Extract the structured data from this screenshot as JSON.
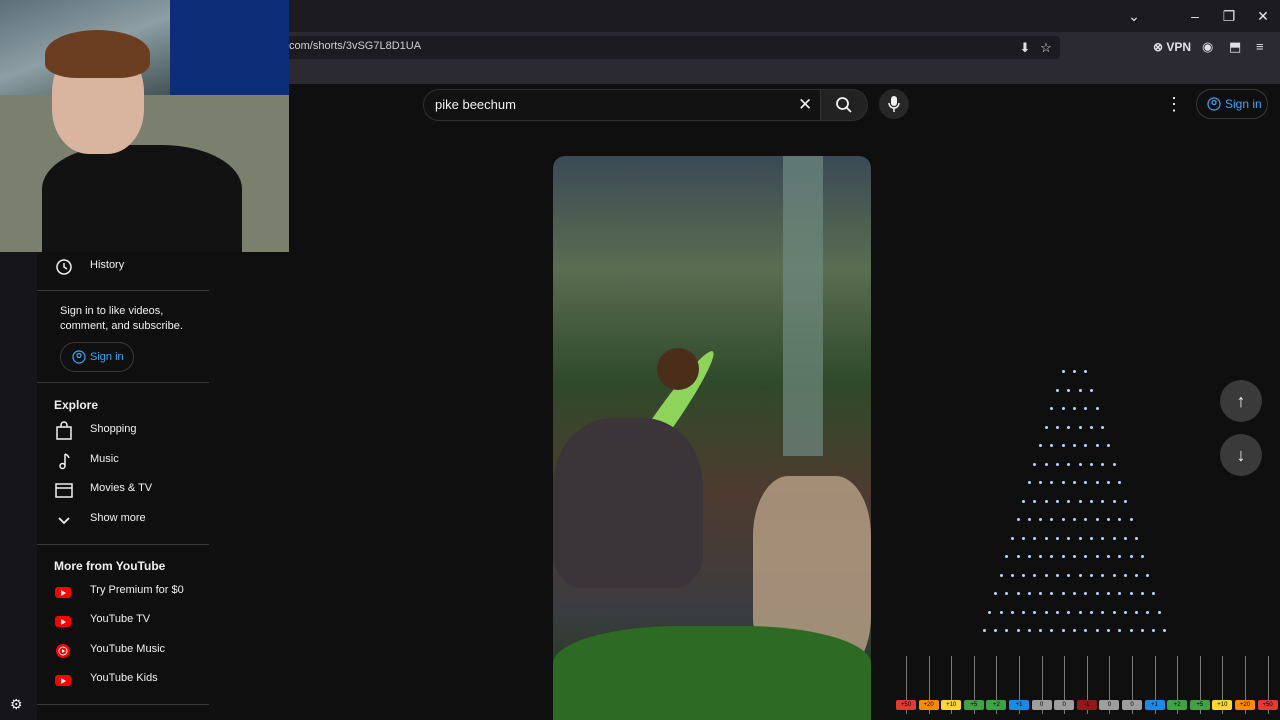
{
  "browser": {
    "url": "com/shorts/3vSG7L8D1UA",
    "vpn_label": "VPN",
    "window_controls": [
      "chevron-down-icon",
      "minimize-icon",
      "restore-icon",
      "close-icon"
    ]
  },
  "header": {
    "search_value": "pike beechum",
    "signin_label": "Sign in"
  },
  "sidebar": {
    "history_label": "History",
    "signin_note": "Sign in to like videos, comment, and subscribe.",
    "signin_label": "Sign in",
    "explore_heading": "Explore",
    "explore_items": [
      {
        "label": "Shopping",
        "icon": "shopping-bag-icon"
      },
      {
        "label": "Music",
        "icon": "music-note-icon"
      },
      {
        "label": "Movies & TV",
        "icon": "clapperboard-icon"
      },
      {
        "label": "Show more",
        "icon": "chevron-down-icon"
      }
    ],
    "more_heading": "More from YouTube",
    "more_items": [
      {
        "label": "Try Premium for $0",
        "icon": "youtube-premium-icon"
      },
      {
        "label": "YouTube TV",
        "icon": "youtube-tv-icon"
      },
      {
        "label": "YouTube Music",
        "icon": "youtube-music-icon"
      },
      {
        "label": "YouTube Kids",
        "icon": "youtube-kids-icon"
      }
    ]
  },
  "visualizer": {
    "meter_labels": [
      "+50",
      "+20",
      "+10",
      "+5",
      "+2",
      "+1",
      "0",
      "0",
      "-1",
      "0",
      "0",
      "+1",
      "+2",
      "+5",
      "+10",
      "+20",
      "+50"
    ],
    "meter_colors": [
      "#e53935",
      "#fb8c00",
      "#fdd835",
      "#43a047",
      "#43a047",
      "#1e88e5",
      "#9e9e9e",
      "#9e9e9e",
      "#8e1b1b",
      "#9e9e9e",
      "#9e9e9e",
      "#1e88e5",
      "#43a047",
      "#43a047",
      "#fdd835",
      "#fb8c00",
      "#e53935"
    ]
  },
  "colors": {
    "accent_link": "#3ea6ff",
    "youtube_red": "#ff0000"
  }
}
